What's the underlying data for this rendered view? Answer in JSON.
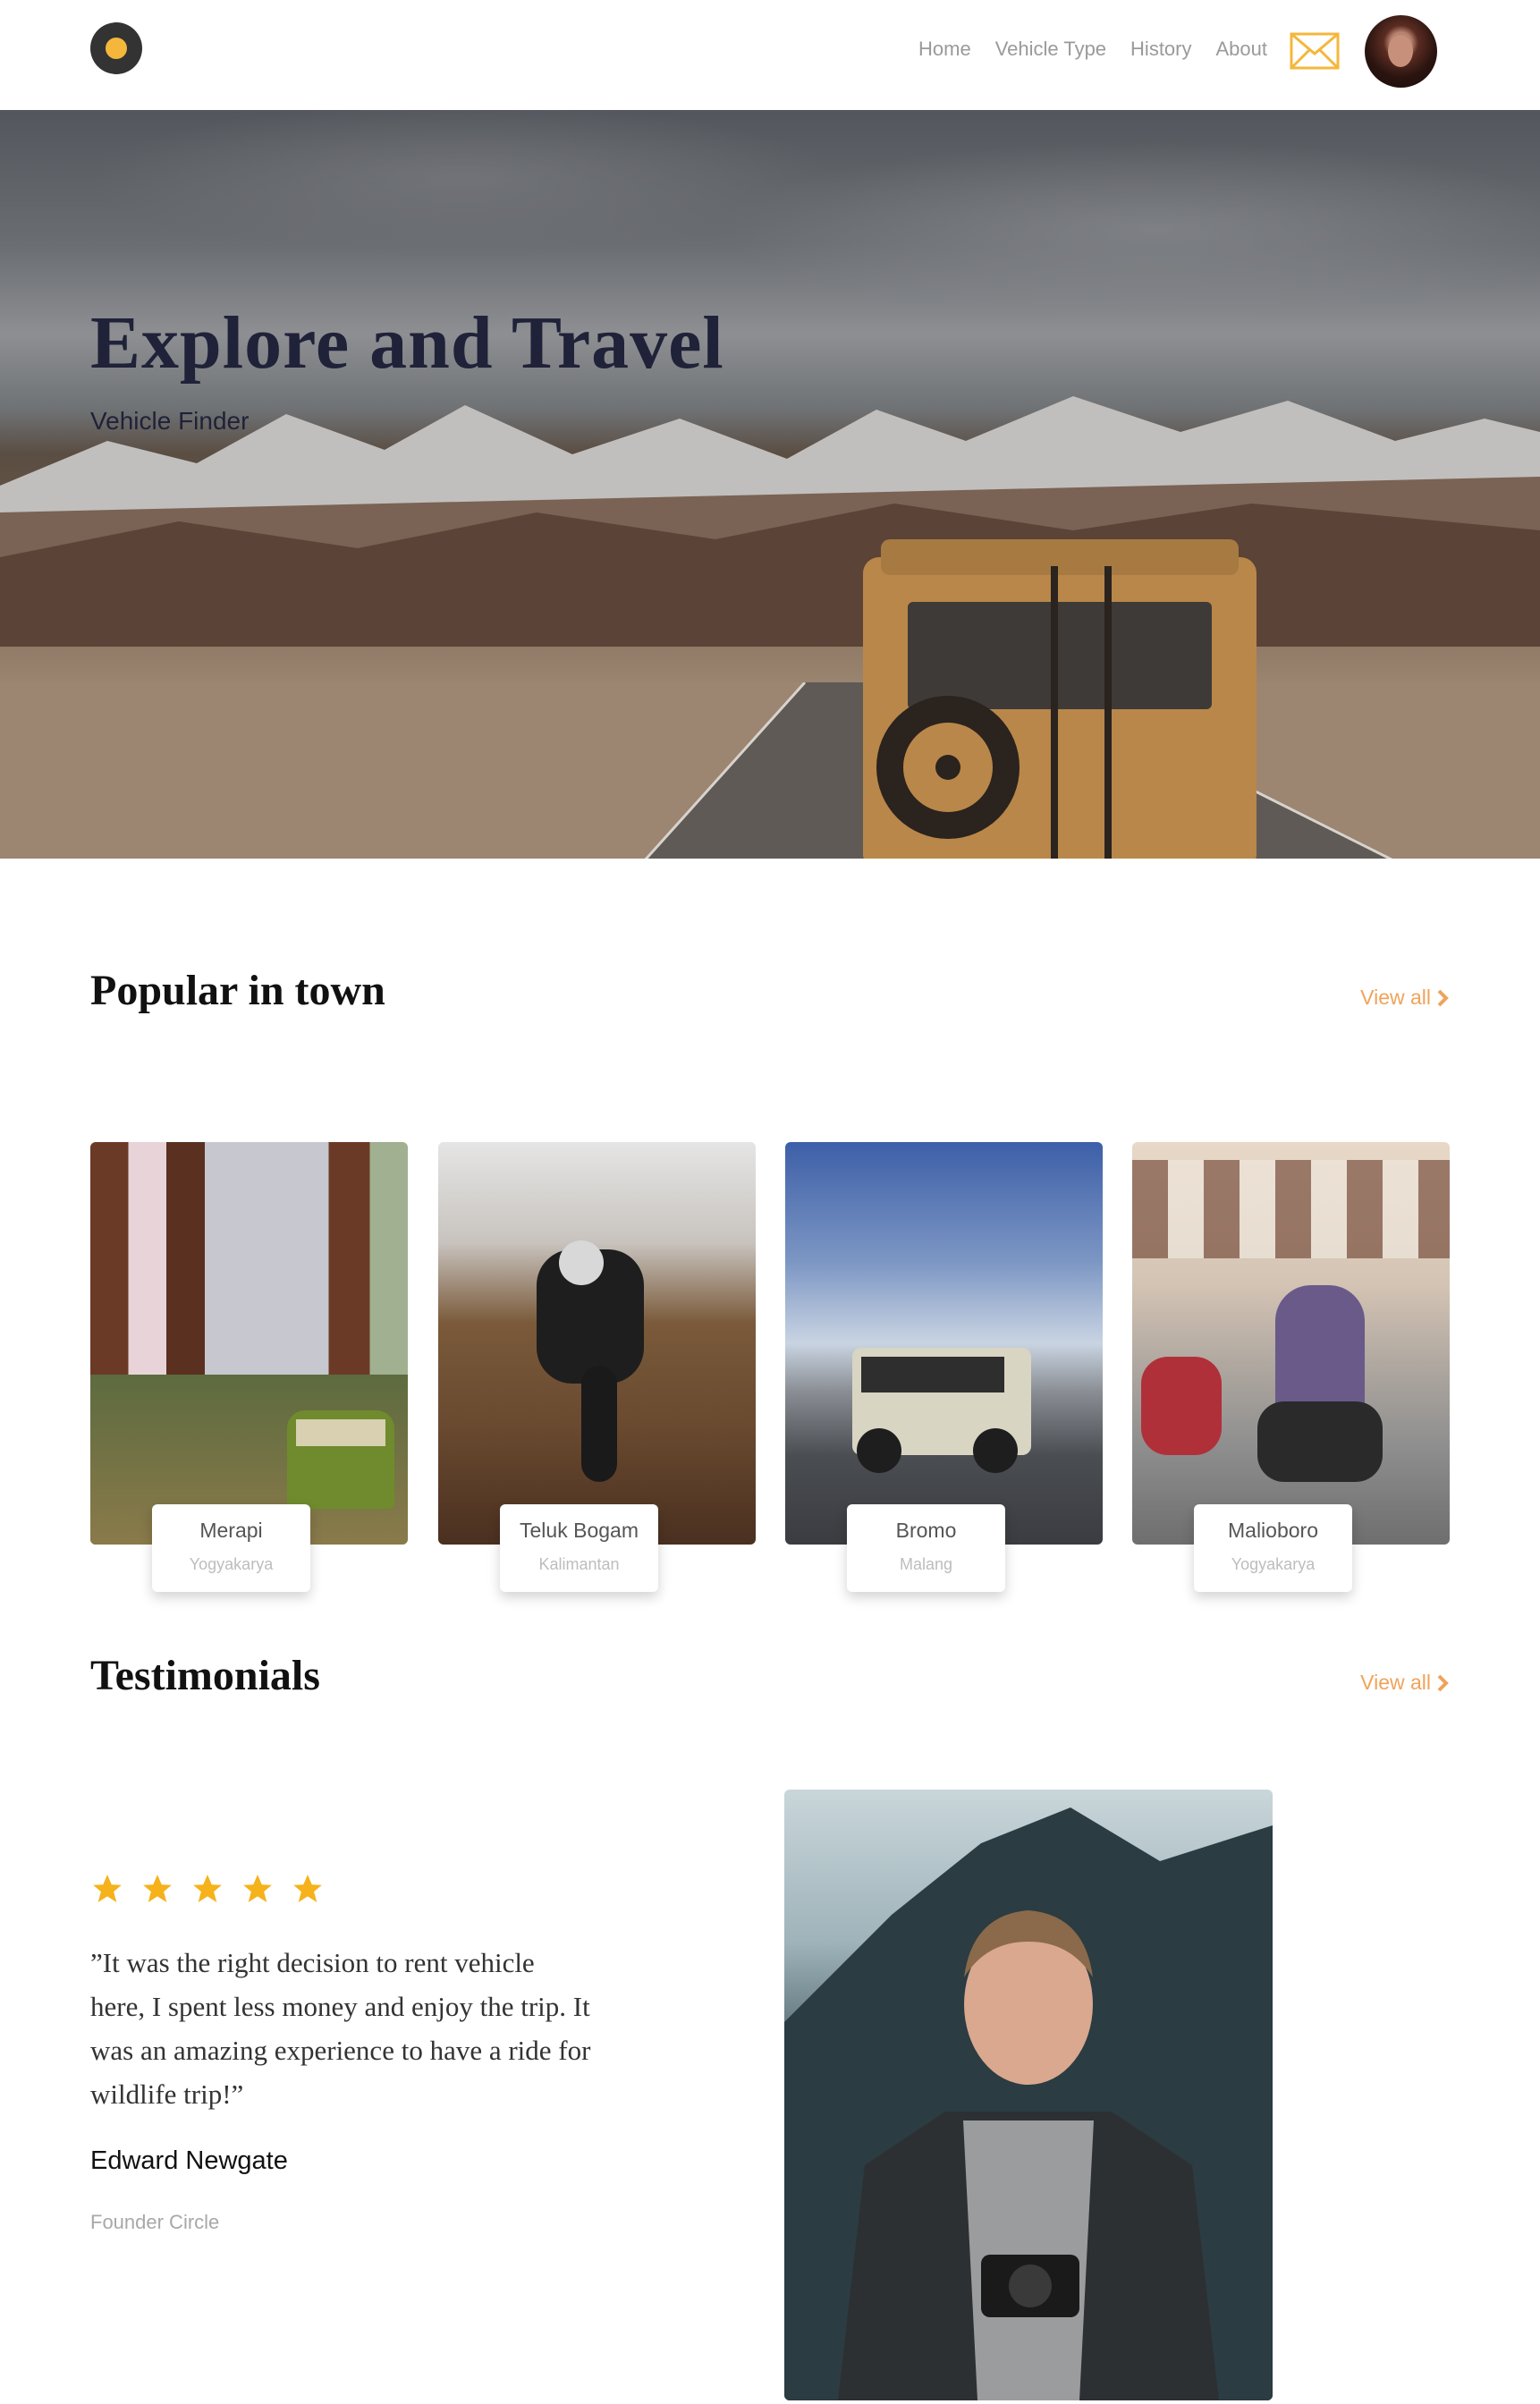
{
  "nav": {
    "links": [
      "Home",
      "Vehicle Type",
      "History",
      "About"
    ],
    "mail_icon": "mail-icon",
    "accent_color": "#f4b73c"
  },
  "hero": {
    "title": "Explore and Travel",
    "subtitle": "Vehicle Finder"
  },
  "popular": {
    "title": "Popular in town",
    "view_all": "View all",
    "cards": [
      {
        "name": "Merapi",
        "location": "Yogyakarya"
      },
      {
        "name": "Teluk Bogam",
        "location": "Kalimantan"
      },
      {
        "name": "Bromo",
        "location": "Malang"
      },
      {
        "name": "Malioboro",
        "location": "Yogyakarya"
      }
    ]
  },
  "testimonials": {
    "title": "Testimonials",
    "view_all": "View all",
    "rating": 5,
    "quote": "”It was the right decision to rent vehicle here, I spent less money and enjoy the trip. It was an amazing experience to have a ride for wildlife trip!”",
    "author": "Edward Newgate",
    "role": "Founder Circle",
    "star_color": "#f5b21a",
    "link_color": "#f0a35a"
  }
}
